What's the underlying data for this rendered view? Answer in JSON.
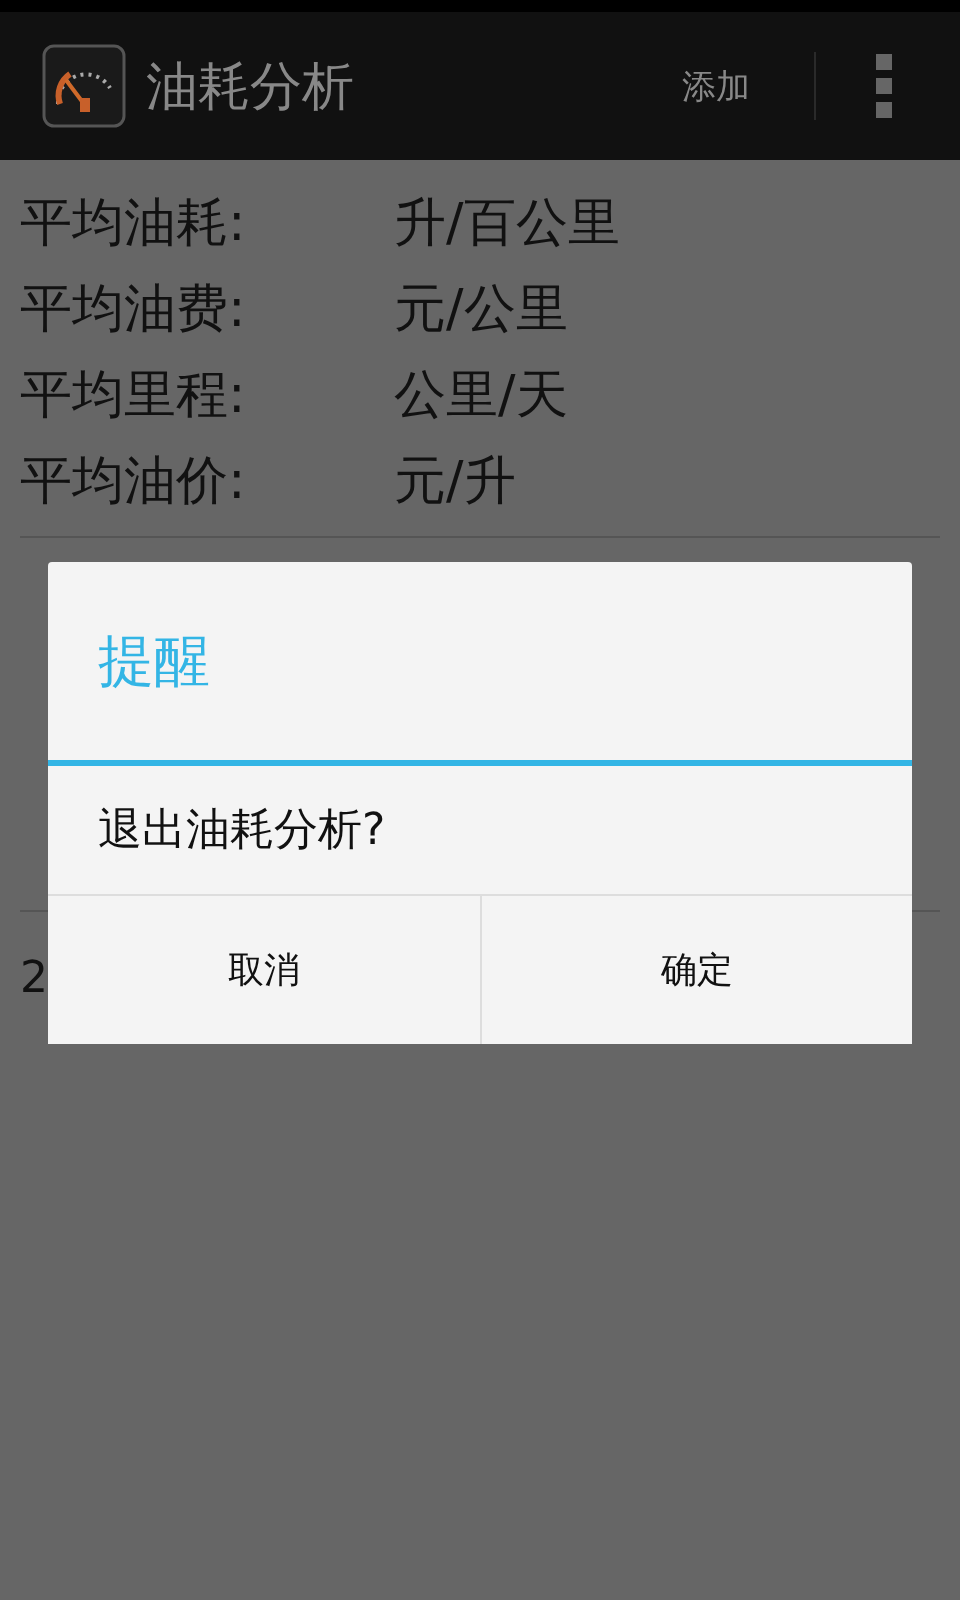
{
  "action_bar": {
    "title": "油耗分析",
    "action": "添加"
  },
  "averages": [
    {
      "label": "平均油耗:",
      "unit": "升/百公里"
    },
    {
      "label": "平均油费:",
      "unit": "元/公里"
    },
    {
      "label": "平均里程:",
      "unit": "公里/天"
    },
    {
      "label": "平均油价:",
      "unit": "元/升"
    }
  ],
  "records": [
    "2"
  ],
  "dialog": {
    "title": "提醒",
    "message": "退出油耗分析?",
    "buttons": [
      "取消",
      "确定"
    ]
  }
}
